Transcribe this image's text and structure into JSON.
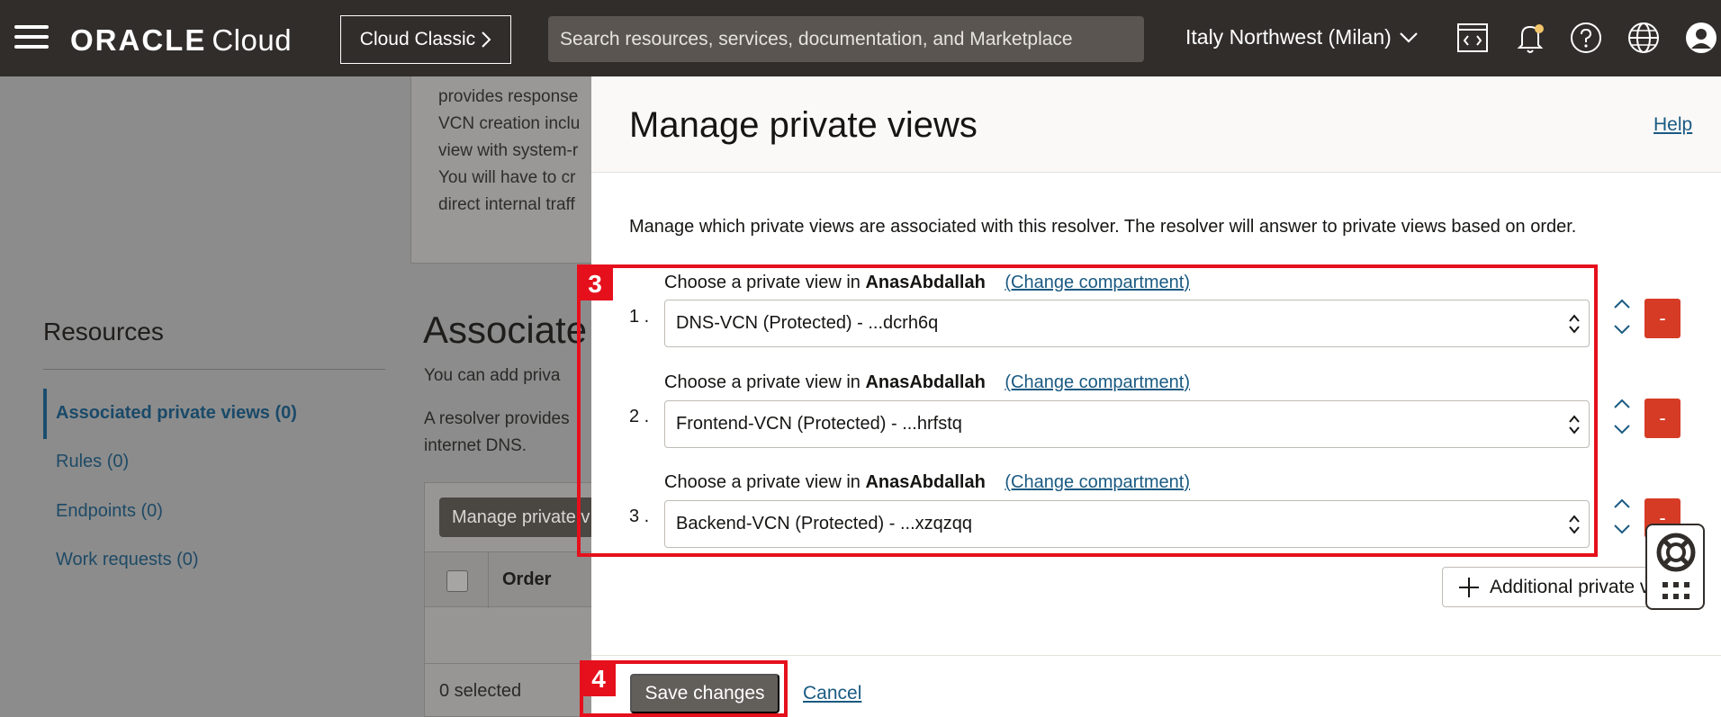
{
  "topbar": {
    "logo_brand": "ORACLE",
    "logo_product": "Cloud",
    "classic_button": "Cloud Classic",
    "search_placeholder": "Search resources, services, documentation, and Marketplace",
    "region": "Italy Northwest (Milan)"
  },
  "background": {
    "card_lines": [
      "provides response",
      "VCN creation inclu",
      "view with system-r",
      "You will have to cr",
      "direct internal traff"
    ],
    "resources_title": "Resources",
    "resources_items": [
      {
        "label": "Associated private views (0)",
        "active": true
      },
      {
        "label": "Rules (0)",
        "active": false
      },
      {
        "label": "Endpoints (0)",
        "active": false
      },
      {
        "label": "Work requests (0)",
        "active": false
      }
    ],
    "section_title": "Associate",
    "section_text_1": "You can add priva",
    "section_text_2a": "A resolver provides",
    "section_text_2b": "internet DNS.",
    "manage_button": "Manage private v",
    "column_order": "Order",
    "selected_count": "0 selected"
  },
  "panel": {
    "title": "Manage private views",
    "help": "Help",
    "description": "Manage which private views are associated with this resolver. The resolver will answer to private views based on order.",
    "choose_prefix": "Choose a private view in",
    "change_compartment": "(Change compartment)",
    "rows": [
      {
        "number": "1 .",
        "compartment": "AnasAbdallah",
        "value": "DNS-VCN (Protected) - ...dcrh6q"
      },
      {
        "number": "2 .",
        "compartment": "AnasAbdallah",
        "value": "Frontend-VCN (Protected) - ...hrfstq"
      },
      {
        "number": "3 .",
        "compartment": "AnasAbdallah",
        "value": "Backend-VCN (Protected) - ...xzqzqq"
      }
    ],
    "minus_label": "-",
    "add_button": "Additional private v",
    "save_button": "Save changes",
    "cancel": "Cancel"
  },
  "annotations": {
    "step_3": "3",
    "step_4": "4",
    "color": "#e5101c"
  }
}
